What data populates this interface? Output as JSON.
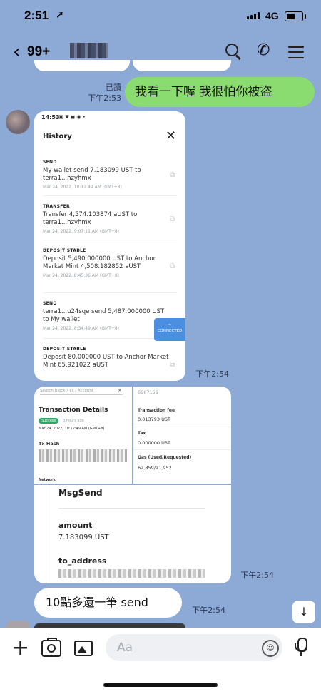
{
  "status_bar": {
    "time": "2:51",
    "location_glyph": "➚",
    "network": "4G"
  },
  "header": {
    "back_glyph": "‹",
    "unread_count": "99+"
  },
  "messages": {
    "sent_read": "已讀",
    "sent_time": "下午2:53",
    "sent_text": "我看一下喔 我很怕你被盜",
    "history_time": "下午2:54",
    "tx_time": "下午2:54",
    "text_message": "10點多還一筆 send",
    "text_time": "下午2:54"
  },
  "history_card": {
    "status_time": "14:53",
    "status_icons": "▣ ♥ ◼ ◉ •",
    "title": "History",
    "close_glyph": "✕",
    "connected_label": "CONNECTED",
    "entries": [
      {
        "kind": "SEND",
        "desc": "My wallet send 7.183099 UST to terra1...hzyhmx",
        "time": "Mar 24, 2022, 10:12:49 AM (GMT+8)"
      },
      {
        "kind": "TRANSFER",
        "desc": "Transfer 4,574.103874 aUST to terra1...hzyhmx",
        "time": "Mar 24, 2022, 9:07:11 AM (GMT+8)"
      },
      {
        "kind": "DEPOSIT STABLE",
        "desc": "Deposit 5,490.000000 UST to Anchor Market Mint 4,508.182852 aUST",
        "time": "Mar 24, 2022, 8:45:36 AM (GMT+8)"
      },
      {
        "kind": "SEND",
        "desc": "terra1...u24sqe send 5,487.000000 UST to My wallet",
        "time": "Mar 24, 2022, 8:34:49 AM (GMT+8)"
      },
      {
        "kind": "DEPOSIT STABLE",
        "desc": "Deposit 80.000000 UST to Anchor Market Mint 65.921022 aUST",
        "time": ""
      }
    ]
  },
  "tx_tiles": {
    "search_placeholder": "Search Block / Tx / Account",
    "title": "Transaction Details",
    "status": "Success",
    "ago": "3 hours ago",
    "date": "Mar 24, 2022, 10:12:49 AM (GMT+8)",
    "tx_hash_label": "Tx Hash",
    "network_label": "Network",
    "right_top": "6967159",
    "fee_label": "Transaction fee",
    "fee_value": "0.013793 UST",
    "tax_label": "Tax",
    "tax_value": "0.000000 UST",
    "gas_label": "Gas (Used/Requested)",
    "gas_value": "62,859/91,952",
    "msg_label": "MsgSend",
    "amount_label": "amount",
    "amount_value": "7.183099 UST",
    "to_label": "to_address"
  },
  "composer": {
    "placeholder": "Aa",
    "scroll_glyph": "↓"
  }
}
